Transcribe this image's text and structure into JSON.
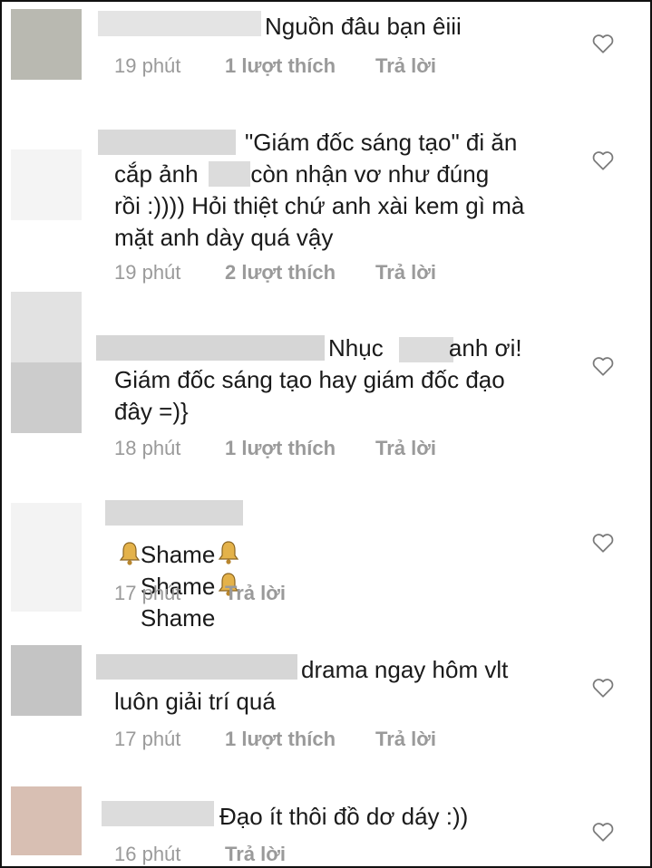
{
  "comments": [
    {
      "avatar_color": "#b9b9b1",
      "text": "Nguồn đâu bạn êiii",
      "time": "19 phút",
      "likes": "1 lượt thích",
      "reply": "Trả lời"
    },
    {
      "avatar_color": "#f4f4f4",
      "text": "\"Giám đốc sáng tạo\" đi ăn\ncắp ảnh        còn nhận vơ như đúng\nrồi :)))) Hỏi thiệt chứ anh xài kem gì mà\nmặt anh dày quá vậy",
      "time": "19 phút",
      "likes": "2 lượt thích",
      "reply": "Trả lời"
    },
    {
      "avatar_color": "#cfcfcf",
      "text": "Nhục          anh ơi!\nGiám đốc sáng tạo hay giám đốc đạo\nđây =)}",
      "time": "18 phút",
      "likes": "1 lượt thích",
      "reply": "Trả lời"
    },
    {
      "avatar_color": "#f3f3f3",
      "text": "Shame",
      "text_2": "Shame",
      "text_3": "Shame",
      "time": "17 phút",
      "reply": "Trả lời",
      "bell_icon": "bell-icon"
    },
    {
      "avatar_color": "#c4c4c4",
      "text": "drama ngay hôm vlt\nluôn giải trí quá",
      "time": "17 phút",
      "likes": "1 lượt thích",
      "reply": "Trả lời"
    },
    {
      "avatar_color": "#d8bfb3",
      "text": "Đạo ít thôi đồ dơ dáy :))",
      "time": "16 phút",
      "reply": "Trả lời"
    }
  ],
  "icons": {
    "heart": "heart-outline-icon",
    "bell": "bell-icon"
  }
}
